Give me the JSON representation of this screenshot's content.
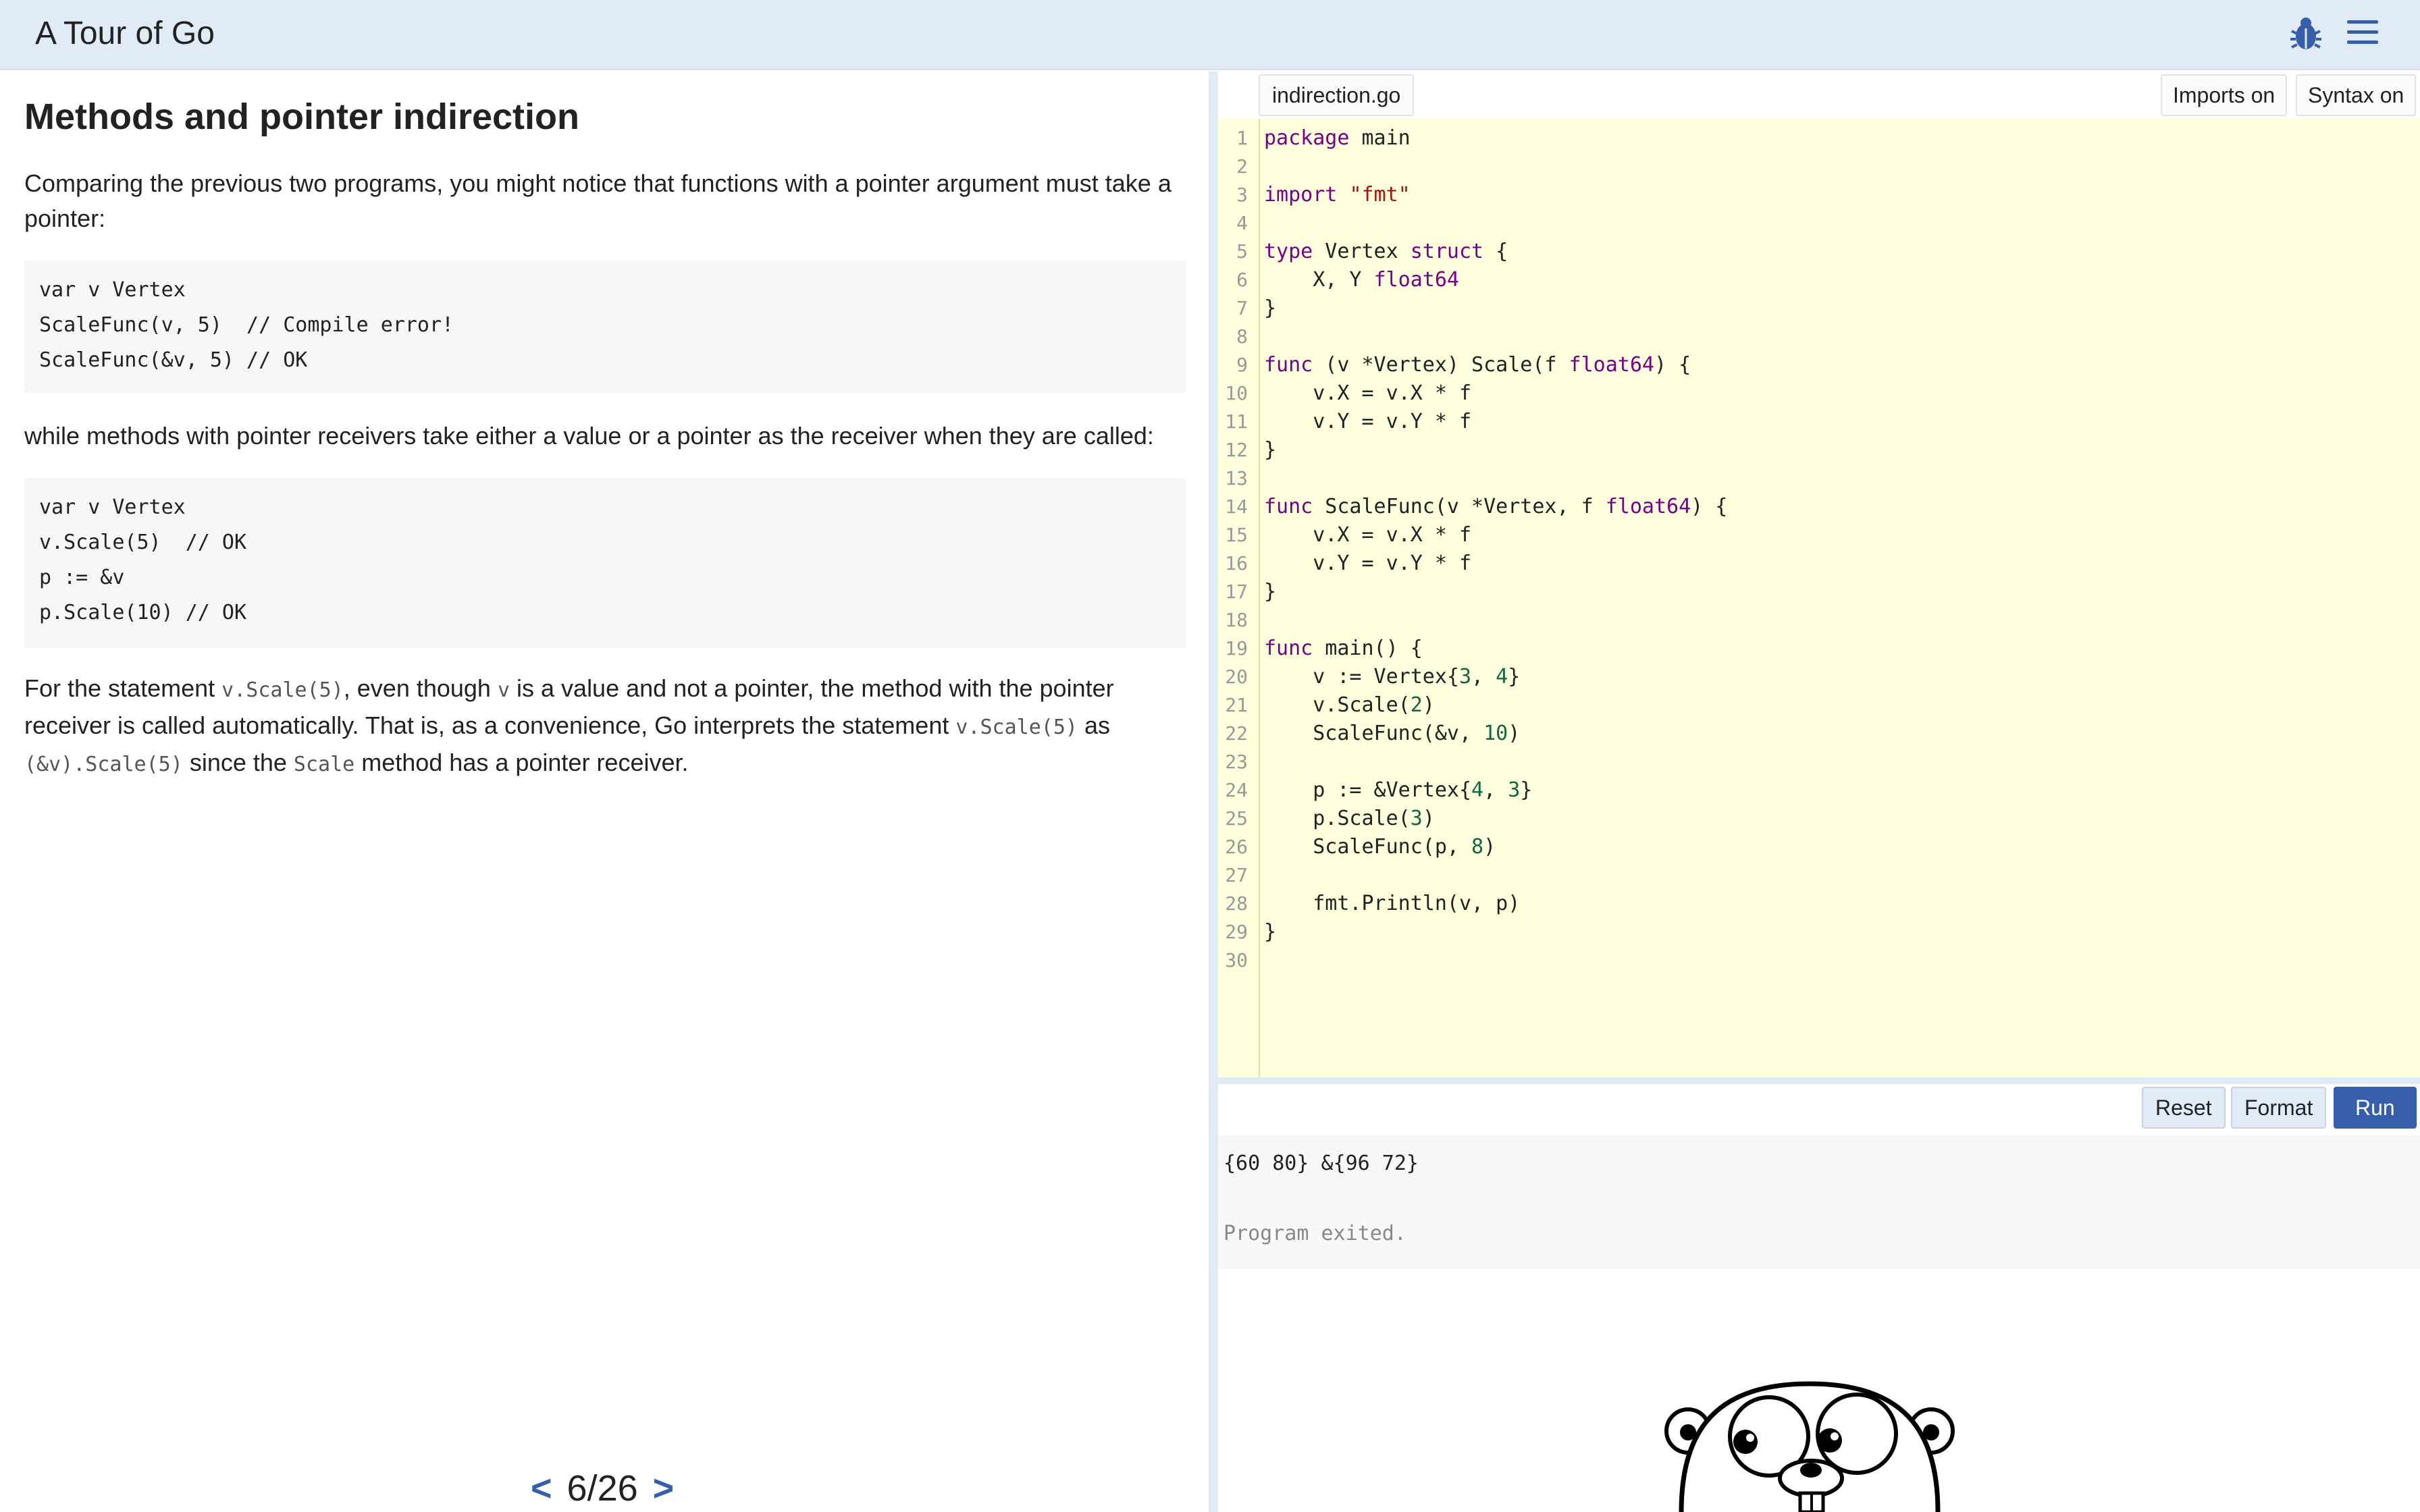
{
  "header": {
    "title": "A Tour of Go",
    "icons": [
      "bug-icon",
      "menu-icon"
    ]
  },
  "lesson": {
    "title": "Methods and pointer indirection",
    "para1": "Comparing the previous two programs, you might notice that functions with a pointer argument must take a pointer:",
    "code1": [
      "var v Vertex",
      "ScaleFunc(v, 5)  // Compile error!",
      "ScaleFunc(&v, 5) // OK"
    ],
    "para2": "while methods with pointer receivers take either a value or a pointer as the receiver when they are called:",
    "code2": [
      "var v Vertex",
      "v.Scale(5)  // OK",
      "p := &v",
      "p.Scale(10) // OK"
    ],
    "para3": {
      "t1": "For the statement ",
      "c1": "v.Scale(5)",
      "t2": ", even though ",
      "c2": "v",
      "t3": " is a value and not a pointer, the method with the pointer receiver is called automatically. That is, as a convenience, Go interprets the statement ",
      "c3": "v.Scale(5)",
      "t4": " as ",
      "c4": "(&v).Scale(5)",
      "t5": " since the ",
      "c5": "Scale",
      "t6": " method has a pointer receiver."
    }
  },
  "pager": {
    "prev": "<",
    "current": "6/26",
    "next": ">"
  },
  "editor": {
    "filename": "indirection.go",
    "imports_label": "Imports on",
    "syntax_label": "Syntax on",
    "lines": [
      [
        {
          "t": "package",
          "c": "kw"
        },
        {
          "t": " main"
        }
      ],
      [],
      [
        {
          "t": "import",
          "c": "kw"
        },
        {
          "t": " "
        },
        {
          "t": "\"fmt\"",
          "c": "str"
        }
      ],
      [],
      [
        {
          "t": "type",
          "c": "kw"
        },
        {
          "t": " Vertex "
        },
        {
          "t": "struct",
          "c": "kw"
        },
        {
          "t": " {"
        }
      ],
      [
        {
          "t": "    X, Y "
        },
        {
          "t": "float64",
          "c": "kw"
        }
      ],
      [
        {
          "t": "}"
        }
      ],
      [],
      [
        {
          "t": "func",
          "c": "kw"
        },
        {
          "t": " (v *Vertex) Scale(f "
        },
        {
          "t": "float64",
          "c": "kw"
        },
        {
          "t": ") {"
        }
      ],
      [
        {
          "t": "    v.X = v.X * f"
        }
      ],
      [
        {
          "t": "    v.Y = v.Y * f"
        }
      ],
      [
        {
          "t": "}"
        }
      ],
      [],
      [
        {
          "t": "func",
          "c": "kw"
        },
        {
          "t": " ScaleFunc(v *Vertex, f "
        },
        {
          "t": "float64",
          "c": "kw"
        },
        {
          "t": ") {"
        }
      ],
      [
        {
          "t": "    v.X = v.X * f"
        }
      ],
      [
        {
          "t": "    v.Y = v.Y * f"
        }
      ],
      [
        {
          "t": "}"
        }
      ],
      [],
      [
        {
          "t": "func",
          "c": "kw"
        },
        {
          "t": " main() {"
        }
      ],
      [
        {
          "t": "    v := Vertex{"
        },
        {
          "t": "3",
          "c": "num"
        },
        {
          "t": ", "
        },
        {
          "t": "4",
          "c": "num"
        },
        {
          "t": "}"
        }
      ],
      [
        {
          "t": "    v.Scale("
        },
        {
          "t": "2",
          "c": "num"
        },
        {
          "t": ")"
        }
      ],
      [
        {
          "t": "    ScaleFunc(&v, "
        },
        {
          "t": "10",
          "c": "num"
        },
        {
          "t": ")"
        }
      ],
      [],
      [
        {
          "t": "    p := &Vertex{"
        },
        {
          "t": "4",
          "c": "num"
        },
        {
          "t": ", "
        },
        {
          "t": "3",
          "c": "num"
        },
        {
          "t": "}"
        }
      ],
      [
        {
          "t": "    p.Scale("
        },
        {
          "t": "3",
          "c": "num"
        },
        {
          "t": ")"
        }
      ],
      [
        {
          "t": "    ScaleFunc(p, "
        },
        {
          "t": "8",
          "c": "num"
        },
        {
          "t": ")"
        }
      ],
      [],
      [
        {
          "t": "    fmt.Println(v, p)"
        }
      ],
      [
        {
          "t": "}"
        }
      ],
      []
    ]
  },
  "actions": {
    "reset": "Reset",
    "format": "Format",
    "run": "Run"
  },
  "output": {
    "result": "{60 80} &{96 72}",
    "status": "Program exited."
  },
  "colors": {
    "header_bg": "#e0ebf5",
    "accent": "#375eab",
    "editor_bg": "#ffffdd",
    "keyword": "#770088",
    "string": "#aa1111",
    "number": "#116644"
  },
  "mascot": "gopher-image"
}
